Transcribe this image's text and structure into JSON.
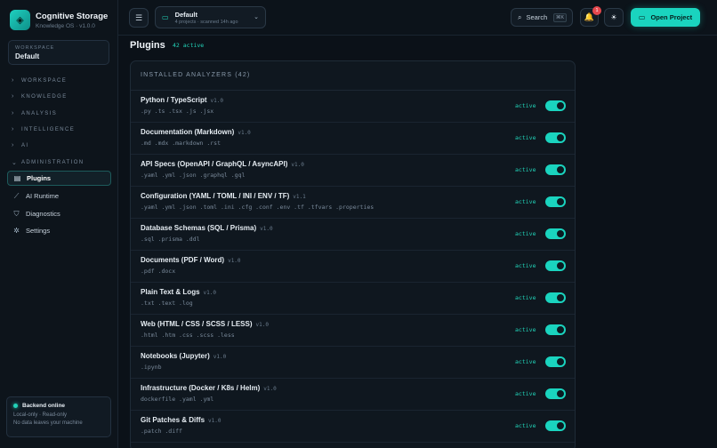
{
  "brand": {
    "name": "Cognitive Storage",
    "version": "Knowledge OS · v1.0.0"
  },
  "workspace": {
    "label": "WORKSPACE",
    "value": "Default"
  },
  "nav": {
    "sections": [
      {
        "label": "WORKSPACE",
        "expanded": false
      },
      {
        "label": "KNOWLEDGE",
        "expanded": false
      },
      {
        "label": "ANALYSIS",
        "expanded": false
      },
      {
        "label": "INTELLIGENCE",
        "expanded": false
      },
      {
        "label": "AI",
        "expanded": false
      },
      {
        "label": "ADMINISTRATION",
        "expanded": true
      }
    ],
    "items": [
      {
        "label": "Plugins",
        "icon": "plugin-icon",
        "active": true
      },
      {
        "label": "AI Runtime",
        "icon": "chart-icon",
        "active": false
      },
      {
        "label": "Diagnostics",
        "icon": "shield-icon",
        "active": false
      },
      {
        "label": "Settings",
        "icon": "gear-icon",
        "active": false
      }
    ]
  },
  "backend": {
    "title": "Backend online",
    "line1": "Local-only · Read-only",
    "line2": "No data leaves your machine"
  },
  "header": {
    "project_name": "Default",
    "project_sub": "4 projects · scanned 14h ago",
    "search_label": "Search",
    "search_kbd": "⌘K",
    "notif_count": "1",
    "open_project": "Open Project"
  },
  "page": {
    "title": "Plugins",
    "badge": "42 active"
  },
  "panel": {
    "heading": "INSTALLED ANALYZERS (42)"
  },
  "analyzers": [
    {
      "name": "Python / TypeScript",
      "version": "v1.0",
      "ext": ".py .ts .tsx .js .jsx",
      "status": "active",
      "enabled": true
    },
    {
      "name": "Documentation (Markdown)",
      "version": "v1.0",
      "ext": ".md .mdx .markdown .rst",
      "status": "active",
      "enabled": true
    },
    {
      "name": "API Specs (OpenAPI / GraphQL / AsyncAPI)",
      "version": "v1.0",
      "ext": ".yaml .yml .json .graphql .gql",
      "status": "active",
      "enabled": true
    },
    {
      "name": "Configuration (YAML / TOML / INI / ENV / TF)",
      "version": "v1.1",
      "ext": ".yaml .yml .json .toml .ini .cfg .conf .env .tf .tfvars .properties",
      "status": "active",
      "enabled": true
    },
    {
      "name": "Database Schemas (SQL / Prisma)",
      "version": "v1.0",
      "ext": ".sql .prisma .ddl",
      "status": "active",
      "enabled": true
    },
    {
      "name": "Documents (PDF / Word)",
      "version": "v1.0",
      "ext": ".pdf .docx",
      "status": "active",
      "enabled": true
    },
    {
      "name": "Plain Text & Logs",
      "version": "v1.0",
      "ext": ".txt .text .log",
      "status": "active",
      "enabled": true
    },
    {
      "name": "Web (HTML / CSS / SCSS / LESS)",
      "version": "v1.0",
      "ext": ".html .htm .css .scss .less",
      "status": "active",
      "enabled": true
    },
    {
      "name": "Notebooks (Jupyter)",
      "version": "v1.0",
      "ext": ".ipynb",
      "status": "active",
      "enabled": true
    },
    {
      "name": "Infrastructure (Docker / K8s / Helm)",
      "version": "v1.0",
      "ext": "dockerfile .yaml .yml",
      "status": "active",
      "enabled": true
    },
    {
      "name": "Git Patches & Diffs",
      "version": "v1.0",
      "ext": ".patch .diff",
      "status": "active",
      "enabled": true
    }
  ],
  "colors": {
    "accent": "#1ad4bf",
    "background": "#0b1118",
    "panel": "#0f171f",
    "badge": "#e5484d"
  }
}
